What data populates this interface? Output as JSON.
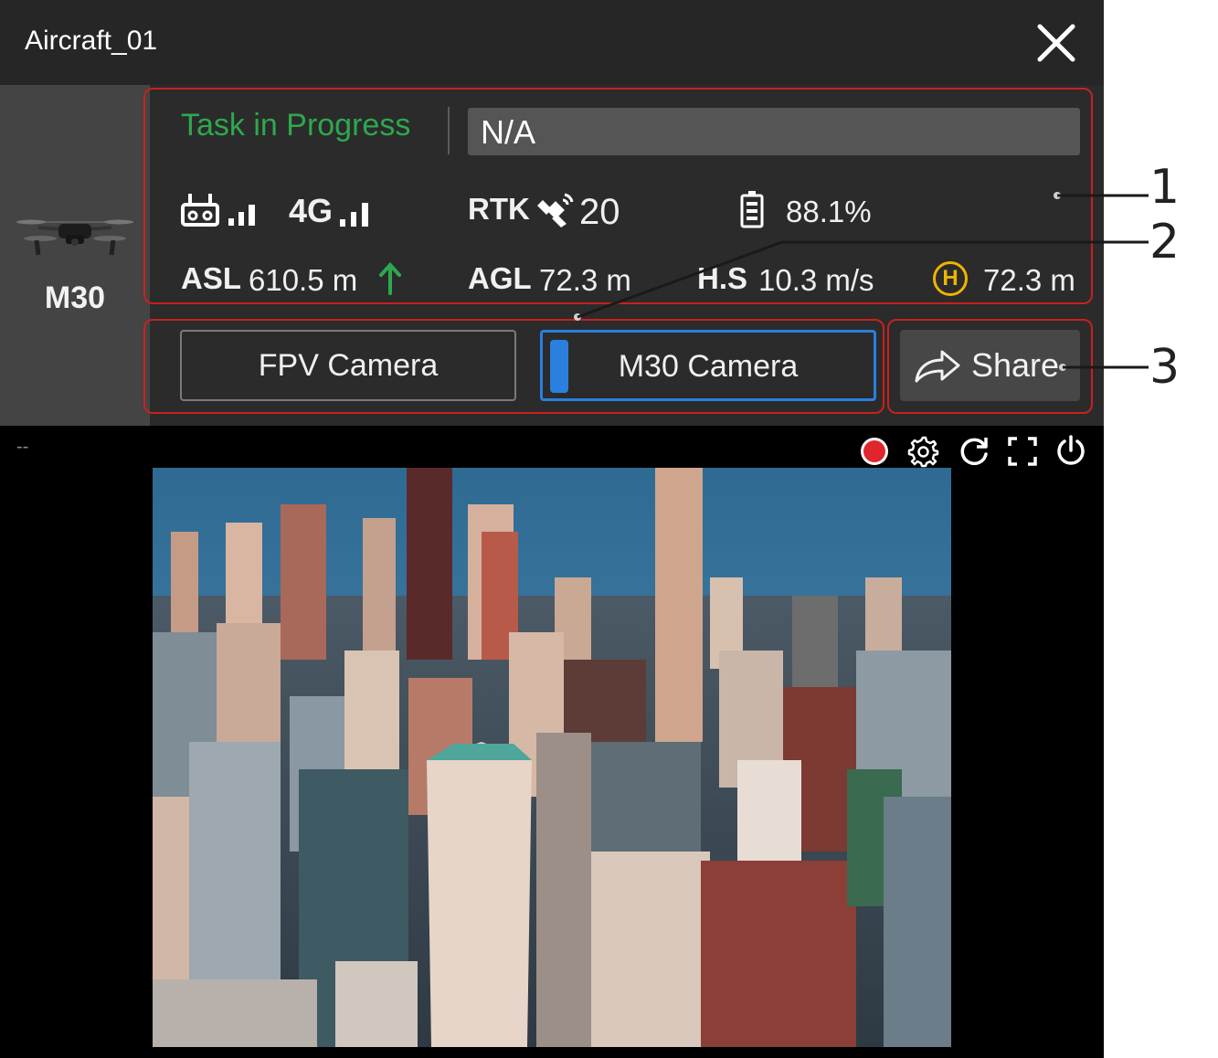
{
  "window": {
    "title": "Aircraft_01"
  },
  "aircraft": {
    "model": "M30"
  },
  "status": {
    "task_label": "Task in Progress",
    "task_value": "N/A",
    "rtk_label": "RTK",
    "rtk_satellites": "20",
    "battery": "88.1%",
    "network": "4G",
    "asl_label": "ASL",
    "asl_value": "610.5 m",
    "agl_label": "AGL",
    "agl_value": "72.3 m",
    "hs_label": "H.S",
    "hs_value": "10.3 m/s",
    "home_label": "H",
    "home_value": "72.3 m"
  },
  "cameras": {
    "fpv_label": "FPV Camera",
    "m30_label": "M30 Camera",
    "selected": "M30 Camera"
  },
  "share": {
    "label": "Share"
  },
  "video": {
    "placeholder": "--"
  },
  "callouts": [
    "1",
    "2",
    "3"
  ],
  "colors": {
    "task_green": "#2ea84f",
    "selected_blue": "#2b7fde",
    "annotation_red": "#c8211f",
    "record_red": "#e0262d",
    "home_yellow": "#f0b400"
  }
}
